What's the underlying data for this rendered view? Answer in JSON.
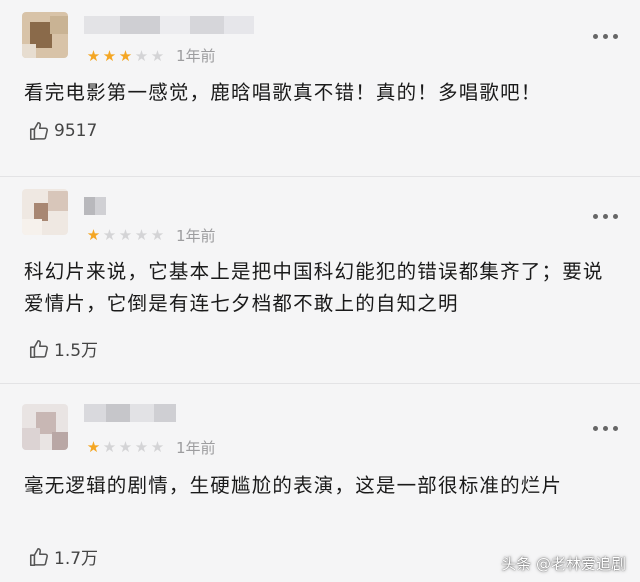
{
  "reviews": [
    {
      "rating": 3,
      "max_rating": 5,
      "time": "1年前",
      "content": "看完电影第一感觉，鹿晗唱歌真不错！真的！多唱歌吧！",
      "likes": "9517",
      "avatar_colors": [
        "#d8c3a8",
        "#8a6a4a",
        "#c9b394",
        "#e7ddd0"
      ]
    },
    {
      "rating": 1,
      "max_rating": 5,
      "time": "1年前",
      "content": "科幻片来说，它基本上是把中国科幻能犯的错误都集齐了；要说爱情片，它倒是有连七夕档都不敢上的自知之明",
      "likes": "1.5万",
      "avatar_colors": [
        "#efe8e2",
        "#a88773",
        "#d8c6ba",
        "#f6f1ec"
      ]
    },
    {
      "rating": 1,
      "max_rating": 5,
      "time": "1年前",
      "content": "毫无逻辑的剧情，生硬尴尬的表演，这是一部很标准的烂片",
      "likes": "1.7万",
      "avatar_colors": [
        "#e9e4e3",
        "#c8b7b4",
        "#dcd3d3",
        "#b9a7a5"
      ]
    }
  ],
  "watermark": "头条 @老林爱追剧",
  "colors": {
    "star_on": "#f4a623",
    "star_off": "#d4d4d6",
    "background": "#f5f5f6"
  },
  "icons": [
    "more-dots-icon",
    "thumbs-up-icon",
    "star-icon"
  ]
}
